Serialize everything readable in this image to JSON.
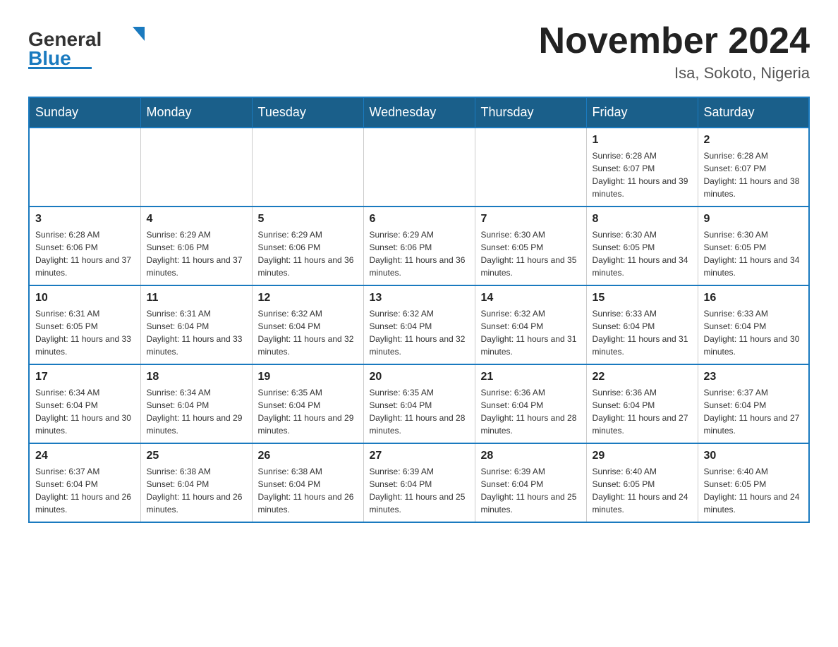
{
  "header": {
    "title": "November 2024",
    "location": "Isa, Sokoto, Nigeria",
    "logo_general": "General",
    "logo_blue": "Blue"
  },
  "weekdays": [
    "Sunday",
    "Monday",
    "Tuesday",
    "Wednesday",
    "Thursday",
    "Friday",
    "Saturday"
  ],
  "weeks": [
    [
      {
        "day": "",
        "sunrise": "",
        "sunset": "",
        "daylight": ""
      },
      {
        "day": "",
        "sunrise": "",
        "sunset": "",
        "daylight": ""
      },
      {
        "day": "",
        "sunrise": "",
        "sunset": "",
        "daylight": ""
      },
      {
        "day": "",
        "sunrise": "",
        "sunset": "",
        "daylight": ""
      },
      {
        "day": "",
        "sunrise": "",
        "sunset": "",
        "daylight": ""
      },
      {
        "day": "1",
        "sunrise": "Sunrise: 6:28 AM",
        "sunset": "Sunset: 6:07 PM",
        "daylight": "Daylight: 11 hours and 39 minutes."
      },
      {
        "day": "2",
        "sunrise": "Sunrise: 6:28 AM",
        "sunset": "Sunset: 6:07 PM",
        "daylight": "Daylight: 11 hours and 38 minutes."
      }
    ],
    [
      {
        "day": "3",
        "sunrise": "Sunrise: 6:28 AM",
        "sunset": "Sunset: 6:06 PM",
        "daylight": "Daylight: 11 hours and 37 minutes."
      },
      {
        "day": "4",
        "sunrise": "Sunrise: 6:29 AM",
        "sunset": "Sunset: 6:06 PM",
        "daylight": "Daylight: 11 hours and 37 minutes."
      },
      {
        "day": "5",
        "sunrise": "Sunrise: 6:29 AM",
        "sunset": "Sunset: 6:06 PM",
        "daylight": "Daylight: 11 hours and 36 minutes."
      },
      {
        "day": "6",
        "sunrise": "Sunrise: 6:29 AM",
        "sunset": "Sunset: 6:06 PM",
        "daylight": "Daylight: 11 hours and 36 minutes."
      },
      {
        "day": "7",
        "sunrise": "Sunrise: 6:30 AM",
        "sunset": "Sunset: 6:05 PM",
        "daylight": "Daylight: 11 hours and 35 minutes."
      },
      {
        "day": "8",
        "sunrise": "Sunrise: 6:30 AM",
        "sunset": "Sunset: 6:05 PM",
        "daylight": "Daylight: 11 hours and 34 minutes."
      },
      {
        "day": "9",
        "sunrise": "Sunrise: 6:30 AM",
        "sunset": "Sunset: 6:05 PM",
        "daylight": "Daylight: 11 hours and 34 minutes."
      }
    ],
    [
      {
        "day": "10",
        "sunrise": "Sunrise: 6:31 AM",
        "sunset": "Sunset: 6:05 PM",
        "daylight": "Daylight: 11 hours and 33 minutes."
      },
      {
        "day": "11",
        "sunrise": "Sunrise: 6:31 AM",
        "sunset": "Sunset: 6:04 PM",
        "daylight": "Daylight: 11 hours and 33 minutes."
      },
      {
        "day": "12",
        "sunrise": "Sunrise: 6:32 AM",
        "sunset": "Sunset: 6:04 PM",
        "daylight": "Daylight: 11 hours and 32 minutes."
      },
      {
        "day": "13",
        "sunrise": "Sunrise: 6:32 AM",
        "sunset": "Sunset: 6:04 PM",
        "daylight": "Daylight: 11 hours and 32 minutes."
      },
      {
        "day": "14",
        "sunrise": "Sunrise: 6:32 AM",
        "sunset": "Sunset: 6:04 PM",
        "daylight": "Daylight: 11 hours and 31 minutes."
      },
      {
        "day": "15",
        "sunrise": "Sunrise: 6:33 AM",
        "sunset": "Sunset: 6:04 PM",
        "daylight": "Daylight: 11 hours and 31 minutes."
      },
      {
        "day": "16",
        "sunrise": "Sunrise: 6:33 AM",
        "sunset": "Sunset: 6:04 PM",
        "daylight": "Daylight: 11 hours and 30 minutes."
      }
    ],
    [
      {
        "day": "17",
        "sunrise": "Sunrise: 6:34 AM",
        "sunset": "Sunset: 6:04 PM",
        "daylight": "Daylight: 11 hours and 30 minutes."
      },
      {
        "day": "18",
        "sunrise": "Sunrise: 6:34 AM",
        "sunset": "Sunset: 6:04 PM",
        "daylight": "Daylight: 11 hours and 29 minutes."
      },
      {
        "day": "19",
        "sunrise": "Sunrise: 6:35 AM",
        "sunset": "Sunset: 6:04 PM",
        "daylight": "Daylight: 11 hours and 29 minutes."
      },
      {
        "day": "20",
        "sunrise": "Sunrise: 6:35 AM",
        "sunset": "Sunset: 6:04 PM",
        "daylight": "Daylight: 11 hours and 28 minutes."
      },
      {
        "day": "21",
        "sunrise": "Sunrise: 6:36 AM",
        "sunset": "Sunset: 6:04 PM",
        "daylight": "Daylight: 11 hours and 28 minutes."
      },
      {
        "day": "22",
        "sunrise": "Sunrise: 6:36 AM",
        "sunset": "Sunset: 6:04 PM",
        "daylight": "Daylight: 11 hours and 27 minutes."
      },
      {
        "day": "23",
        "sunrise": "Sunrise: 6:37 AM",
        "sunset": "Sunset: 6:04 PM",
        "daylight": "Daylight: 11 hours and 27 minutes."
      }
    ],
    [
      {
        "day": "24",
        "sunrise": "Sunrise: 6:37 AM",
        "sunset": "Sunset: 6:04 PM",
        "daylight": "Daylight: 11 hours and 26 minutes."
      },
      {
        "day": "25",
        "sunrise": "Sunrise: 6:38 AM",
        "sunset": "Sunset: 6:04 PM",
        "daylight": "Daylight: 11 hours and 26 minutes."
      },
      {
        "day": "26",
        "sunrise": "Sunrise: 6:38 AM",
        "sunset": "Sunset: 6:04 PM",
        "daylight": "Daylight: 11 hours and 26 minutes."
      },
      {
        "day": "27",
        "sunrise": "Sunrise: 6:39 AM",
        "sunset": "Sunset: 6:04 PM",
        "daylight": "Daylight: 11 hours and 25 minutes."
      },
      {
        "day": "28",
        "sunrise": "Sunrise: 6:39 AM",
        "sunset": "Sunset: 6:04 PM",
        "daylight": "Daylight: 11 hours and 25 minutes."
      },
      {
        "day": "29",
        "sunrise": "Sunrise: 6:40 AM",
        "sunset": "Sunset: 6:05 PM",
        "daylight": "Daylight: 11 hours and 24 minutes."
      },
      {
        "day": "30",
        "sunrise": "Sunrise: 6:40 AM",
        "sunset": "Sunset: 6:05 PM",
        "daylight": "Daylight: 11 hours and 24 minutes."
      }
    ]
  ]
}
